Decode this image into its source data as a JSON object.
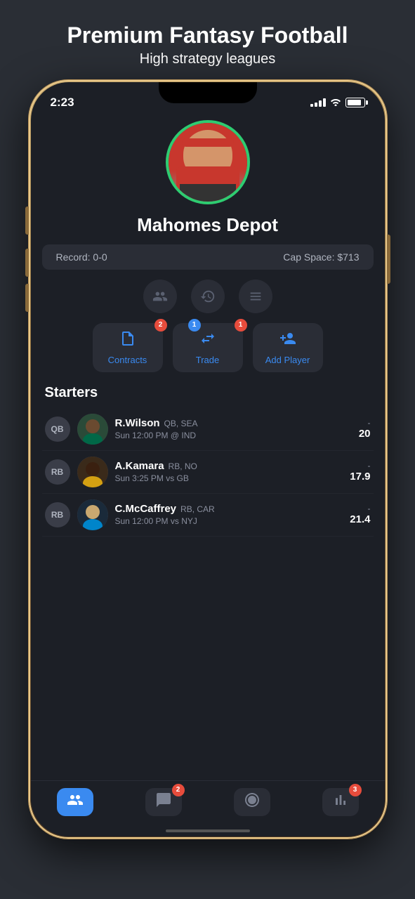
{
  "page": {
    "title": "Premium Fantasy Football",
    "subtitle": "High strategy leagues"
  },
  "status_bar": {
    "time": "2:23",
    "battery_level": 90
  },
  "team": {
    "name": "Mahomes Depot",
    "record_label": "Record: 0-0",
    "cap_space_label": "Cap Space: $713"
  },
  "action_buttons": [
    {
      "id": "contracts",
      "label": "Contracts",
      "badge": "2",
      "badge_type": "red"
    },
    {
      "id": "trade",
      "label": "Trade",
      "badge_left": "1",
      "badge_right": "1",
      "badge_type": "both"
    },
    {
      "id": "add_player",
      "label": "Add Player",
      "badge": null
    }
  ],
  "starters_label": "Starters",
  "players": [
    {
      "position": "QB",
      "name": "R.Wilson",
      "pos_team": "QB, SEA",
      "game": "Sun 12:00 PM @ IND",
      "score_dash": "-",
      "score": "20",
      "skin": "#8a6a50",
      "jersey": "#006847"
    },
    {
      "position": "RB",
      "name": "A.Kamara",
      "pos_team": "RB, NO",
      "game": "Sun 3:25 PM vs GB",
      "score_dash": "-",
      "score": "17.9",
      "skin": "#5a3a2a",
      "jersey": "#d4a012"
    },
    {
      "position": "RB",
      "name": "C.McCaffrey",
      "pos_team": "RB, CAR",
      "game": "Sun 12:00 PM vs NYJ",
      "score_dash": "-",
      "score": "21.4",
      "skin": "#c8a87a",
      "jersey": "#0085ca"
    }
  ],
  "tabs": [
    {
      "id": "roster",
      "active": true,
      "badge": null,
      "icon": "👥"
    },
    {
      "id": "chat",
      "active": false,
      "badge": "2",
      "icon": "💬"
    },
    {
      "id": "football",
      "active": false,
      "badge": null,
      "icon": "🏈"
    },
    {
      "id": "stats",
      "active": false,
      "badge": "3",
      "icon": "📊"
    }
  ]
}
